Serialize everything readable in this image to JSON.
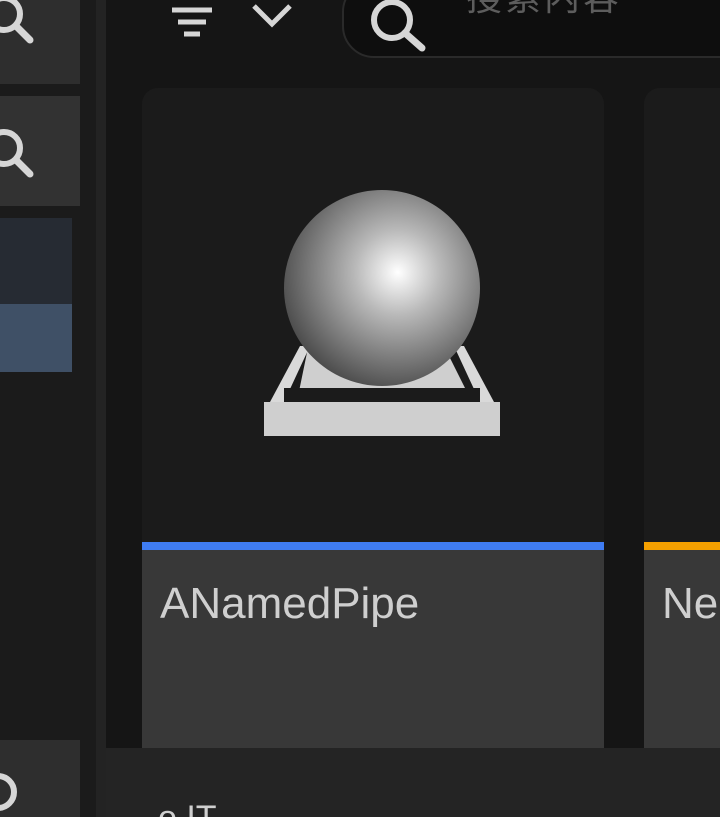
{
  "toolbar": {
    "filter_icon": "filter-lines-icon",
    "dropdown_icon": "chevron-down-icon",
    "search": {
      "icon": "search-icon",
      "placeholder": "搜索内容"
    }
  },
  "left_panel": {
    "top_button_icon": "search-icon",
    "second_button_icon": "search-icon",
    "bottom_button_icon": "search-icon"
  },
  "assets": [
    {
      "name": "ANamedPipe",
      "thumbnail_icon": "sphere-on-pedestal-icon",
      "type_color": "#3f7cf2",
      "selected": false
    },
    {
      "name": "Ne",
      "thumbnail_icon": "",
      "type_color": "#f5a000",
      "selected": false
    }
  ],
  "bottom": {
    "text": "o IT"
  },
  "colors": {
    "background": "#151515",
    "panel": "#1b1b1b",
    "selected_row": "#3f5066",
    "hover_row": "#262b33",
    "tile_label_bg": "#383838"
  }
}
